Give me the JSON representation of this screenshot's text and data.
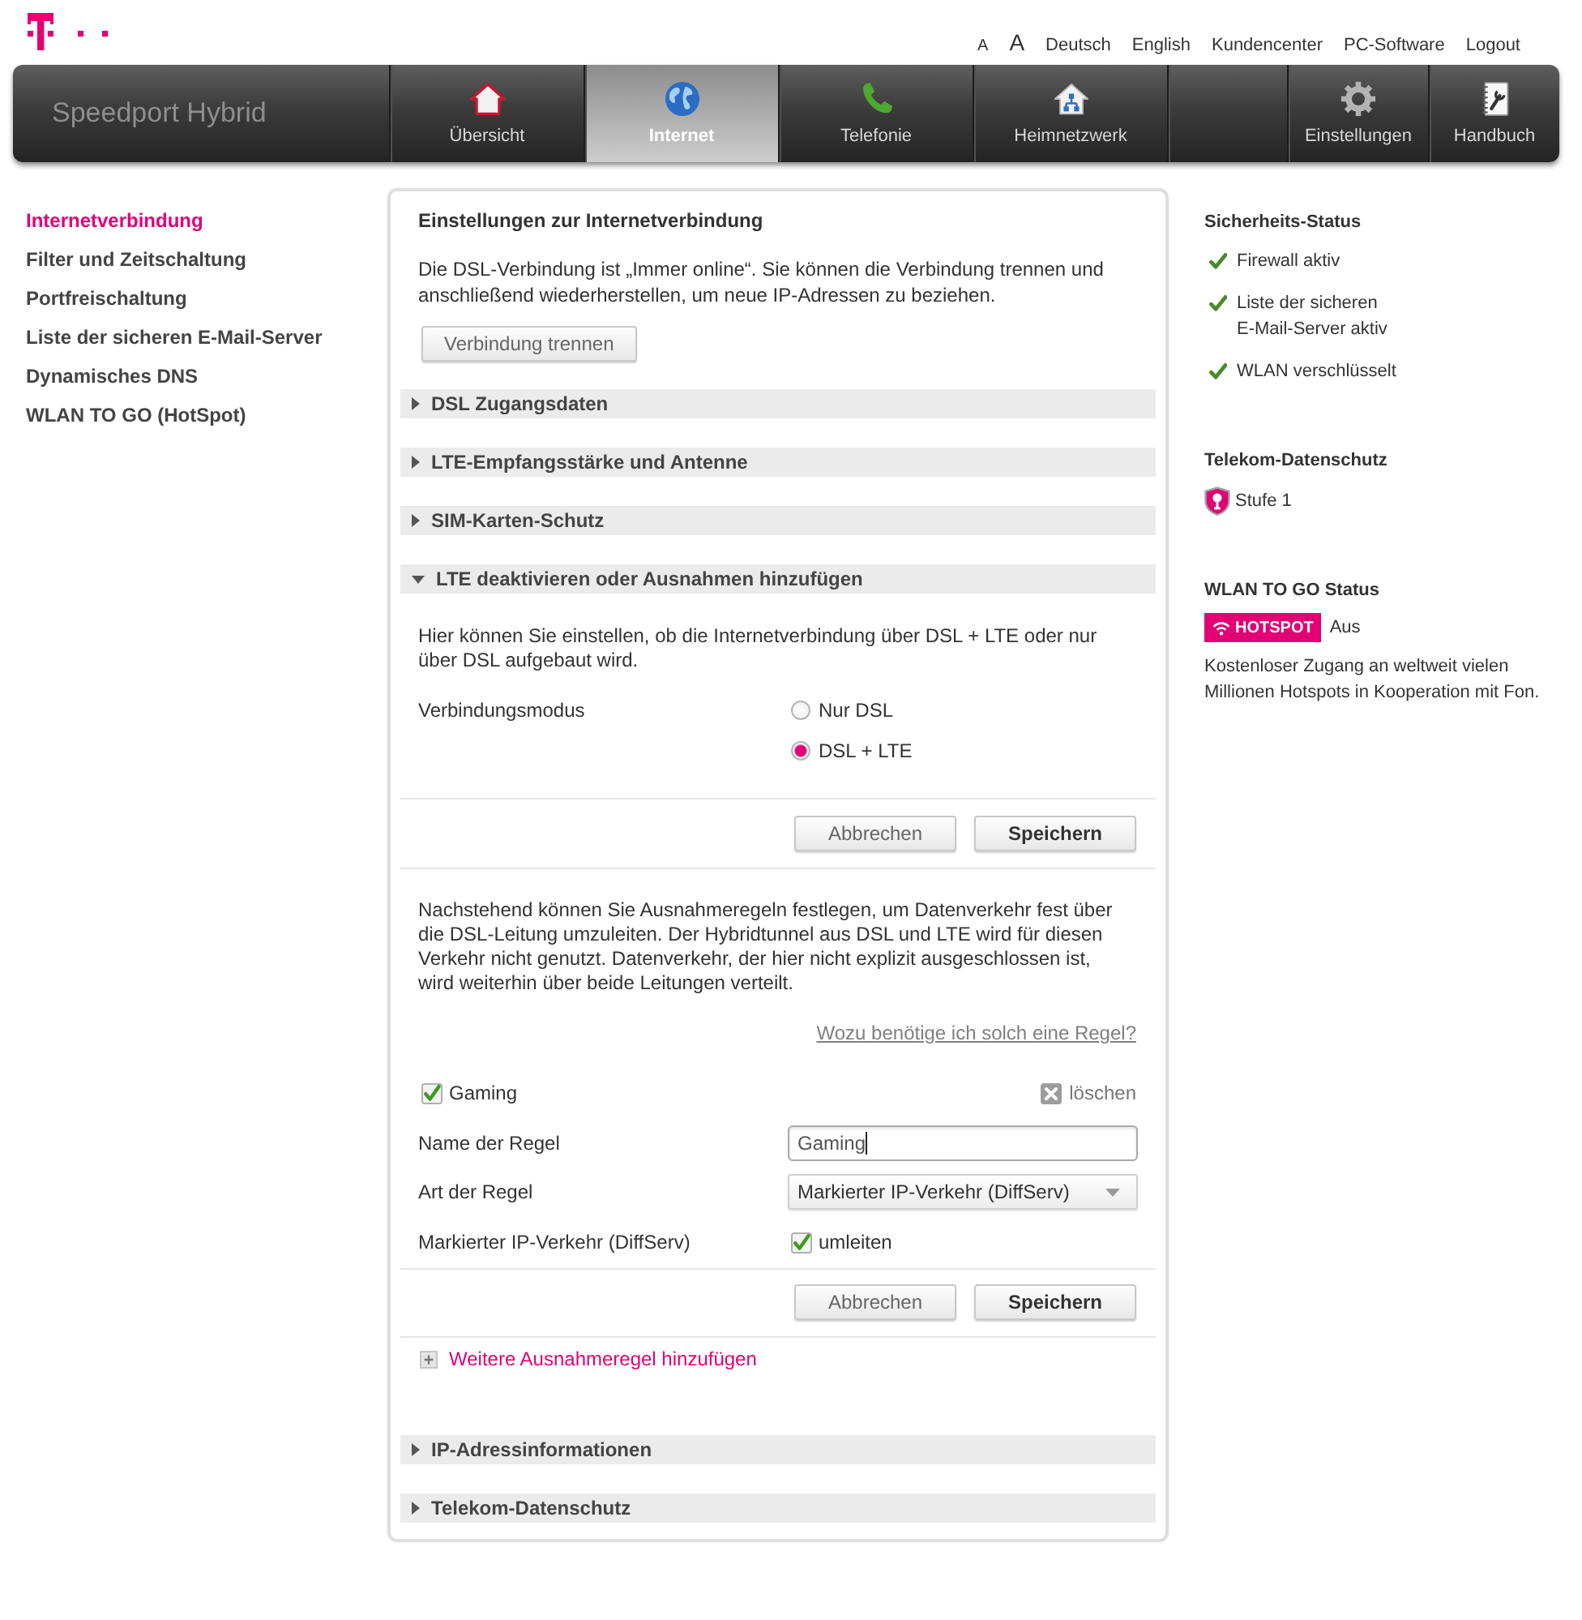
{
  "header": {
    "top_links": [
      {
        "label": "A",
        "kind": "small"
      },
      {
        "label": "A",
        "kind": "large"
      },
      {
        "label": "Deutsch",
        "kind": "link"
      },
      {
        "label": "English",
        "kind": "link"
      },
      {
        "label": "Kundencenter",
        "kind": "link"
      },
      {
        "label": "PC-Software",
        "kind": "link"
      },
      {
        "label": "Logout",
        "kind": "link"
      }
    ]
  },
  "nav": {
    "brand": "Speedport Hybrid",
    "tabs": [
      {
        "label": "Übersicht",
        "selected": false
      },
      {
        "label": "Internet",
        "selected": true
      },
      {
        "label": "Telefonie",
        "selected": false
      },
      {
        "label": "Heimnetzwerk",
        "selected": false
      }
    ],
    "utility_tabs": [
      {
        "label": "Einstellungen",
        "selected": false
      },
      {
        "label": "Handbuch",
        "selected": false
      }
    ]
  },
  "sidebar": {
    "items": [
      {
        "label": "Internetverbindung",
        "selected": true
      },
      {
        "label": "Filter und Zeitschaltung",
        "selected": false
      },
      {
        "label": "Portfreischaltung",
        "selected": false
      },
      {
        "label": "Liste der sicheren E-Mail-Server",
        "selected": false
      },
      {
        "label": "Dynamisches DNS",
        "selected": false
      },
      {
        "label": "WLAN TO GO (HotSpot)",
        "selected": false
      }
    ]
  },
  "main": {
    "title": "Einstellungen zur Internetverbindung",
    "intro": "Die DSL-Verbindung ist „Immer online“. Sie können die Verbindung trennen und anschließend wiederherstellen, um neue IP-Adressen zu beziehen.",
    "disconnect_button": "Verbindung trennen",
    "sections": [
      {
        "title": "DSL Zugangsdaten",
        "expanded": false
      },
      {
        "title": "LTE-Empfangsstärke und Antenne",
        "expanded": false
      },
      {
        "title": "SIM-Karten-Schutz",
        "expanded": false
      },
      {
        "title": "LTE deaktivieren oder Ausnahmen hinzufügen",
        "expanded": true,
        "content": {
          "description": "Hier können Sie einstellen, ob die Internetverbindung über DSL + LTE oder nur über DSL aufgebaut wird.",
          "mode": {
            "label": "Verbindungsmodus",
            "options": [
              {
                "label": "Nur DSL",
                "selected": false
              },
              {
                "label": "DSL + LTE",
                "selected": true
              }
            ]
          },
          "mode_buttons": [
            {
              "label": "Abbrechen",
              "kind": "secondary"
            },
            {
              "label": "Speichern",
              "kind": "primary"
            }
          ],
          "exceptions_text": "Nachstehend können Sie Ausnahmeregeln festlegen, um Datenverkehr fest über die DSL-Leitung umzuleiten. Der Hybridtunnel aus DSL und LTE wird für diesen Verkehr nicht genutzt. Datenverkehr, der hier nicht explizit ausgeschlossen ist, wird weiterhin über beide Leitungen verteilt.",
          "help_link": "Wozu benötige ich solch eine Regel?",
          "rules": [
            {
              "title": "Gaming",
              "checked": true,
              "delete": "löschen",
              "name_label": "Name der Regel",
              "name_value": "Gaming",
              "type_label": "Art der Regel",
              "type_value": "Markierter IP-Verkehr (DiffServ)",
              "option_label": "Markierter IP-Verkehr (DiffServ)",
              "option_text": "umleiten",
              "option_checked": true,
              "buttons": [
                {
                  "label": "Abbrechen",
                  "kind": "secondary"
                },
                {
                  "label": "Speichern",
                  "kind": "primary"
                }
              ]
            }
          ],
          "add_rule": "Weitere Ausnahmeregel hinzufügen"
        }
      },
      {
        "title": "IP-Adressinformationen",
        "expanded": false
      },
      {
        "title": "Telekom-Datenschutz",
        "expanded": false
      }
    ]
  },
  "status_panel": {
    "security": {
      "title": "Sicherheits-Status",
      "items": [
        {
          "text": "Firewall aktiv",
          "ok": true
        },
        {
          "text": "Liste der sicheren\nE-Mail-Server aktiv",
          "ok": true
        },
        {
          "text": "WLAN verschlüsselt",
          "ok": true
        }
      ]
    },
    "privacy": {
      "title": "Telekom-Datenschutz",
      "level_text": "Stufe 1"
    },
    "hotspot": {
      "title": "WLAN TO GO Status",
      "badge": "HOTSPOT",
      "state": "Aus",
      "description": "Kostenloser Zugang an weltweit vielen Millionen Hotspots in Kooperation mit Fon."
    }
  }
}
